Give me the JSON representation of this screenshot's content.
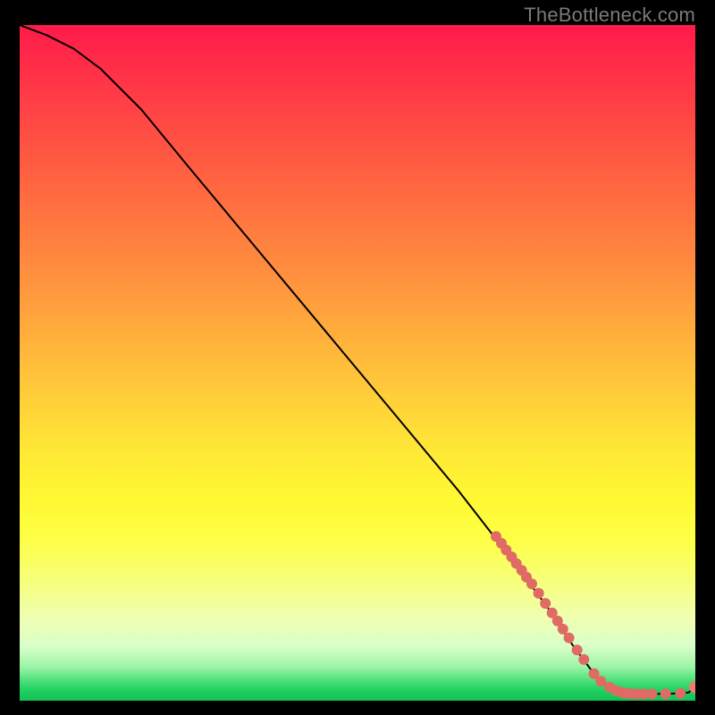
{
  "watermark": "TheBottleneck.com",
  "colors": {
    "dot": "#e06a64",
    "end_dot": "#f07b6e",
    "curve": "#000000"
  },
  "chart_data": {
    "type": "line",
    "title": "",
    "xlabel": "",
    "ylabel": "",
    "xlim": [
      0,
      100
    ],
    "ylim": [
      0,
      100
    ],
    "curve": [
      {
        "x": 0,
        "y": 100
      },
      {
        "x": 4,
        "y": 98.5
      },
      {
        "x": 8,
        "y": 96.5
      },
      {
        "x": 12,
        "y": 93.5
      },
      {
        "x": 18,
        "y": 87.5
      },
      {
        "x": 25,
        "y": 79
      },
      {
        "x": 35,
        "y": 67
      },
      {
        "x": 45,
        "y": 55
      },
      {
        "x": 55,
        "y": 43
      },
      {
        "x": 65,
        "y": 31
      },
      {
        "x": 72,
        "y": 22
      },
      {
        "x": 78,
        "y": 14
      },
      {
        "x": 82,
        "y": 8
      },
      {
        "x": 85,
        "y": 4
      },
      {
        "x": 87,
        "y": 2
      },
      {
        "x": 89,
        "y": 1.2
      },
      {
        "x": 92,
        "y": 1.0
      },
      {
        "x": 96,
        "y": 1.0
      },
      {
        "x": 99,
        "y": 1.2
      },
      {
        "x": 100,
        "y": 2.0
      }
    ],
    "dots": [
      {
        "x": 70.5,
        "y": 24.3,
        "r": 6
      },
      {
        "x": 71.3,
        "y": 23.3,
        "r": 6
      },
      {
        "x": 72.0,
        "y": 22.3,
        "r": 6
      },
      {
        "x": 72.8,
        "y": 21.3,
        "r": 6
      },
      {
        "x": 73.5,
        "y": 20.3,
        "r": 6
      },
      {
        "x": 74.3,
        "y": 19.3,
        "r": 6
      },
      {
        "x": 75.0,
        "y": 18.3,
        "r": 6
      },
      {
        "x": 75.8,
        "y": 17.3,
        "r": 6
      },
      {
        "x": 76.8,
        "y": 15.9,
        "r": 6
      },
      {
        "x": 77.8,
        "y": 14.4,
        "r": 6
      },
      {
        "x": 78.8,
        "y": 13.0,
        "r": 6
      },
      {
        "x": 79.6,
        "y": 11.8,
        "r": 6
      },
      {
        "x": 80.4,
        "y": 10.6,
        "r": 6
      },
      {
        "x": 81.3,
        "y": 9.3,
        "r": 6
      },
      {
        "x": 82.5,
        "y": 7.5,
        "r": 6
      },
      {
        "x": 83.5,
        "y": 6.1,
        "r": 6
      },
      {
        "x": 85.0,
        "y": 4.0,
        "r": 6
      },
      {
        "x": 86.0,
        "y": 2.9,
        "r": 6
      },
      {
        "x": 87.3,
        "y": 2.0,
        "r": 6
      },
      {
        "x": 88.3,
        "y": 1.5,
        "r": 6
      },
      {
        "x": 89.2,
        "y": 1.2,
        "r": 6
      },
      {
        "x": 90.0,
        "y": 1.1,
        "r": 6
      },
      {
        "x": 90.8,
        "y": 1.0,
        "r": 6
      },
      {
        "x": 91.6,
        "y": 1.0,
        "r": 6
      },
      {
        "x": 92.4,
        "y": 1.0,
        "r": 6
      },
      {
        "x": 93.6,
        "y": 1.0,
        "r": 6
      },
      {
        "x": 95.6,
        "y": 1.0,
        "r": 6
      },
      {
        "x": 97.8,
        "y": 1.1,
        "r": 6
      }
    ],
    "end_dot": {
      "x": 100,
      "y": 2.0,
      "r": 7
    }
  }
}
